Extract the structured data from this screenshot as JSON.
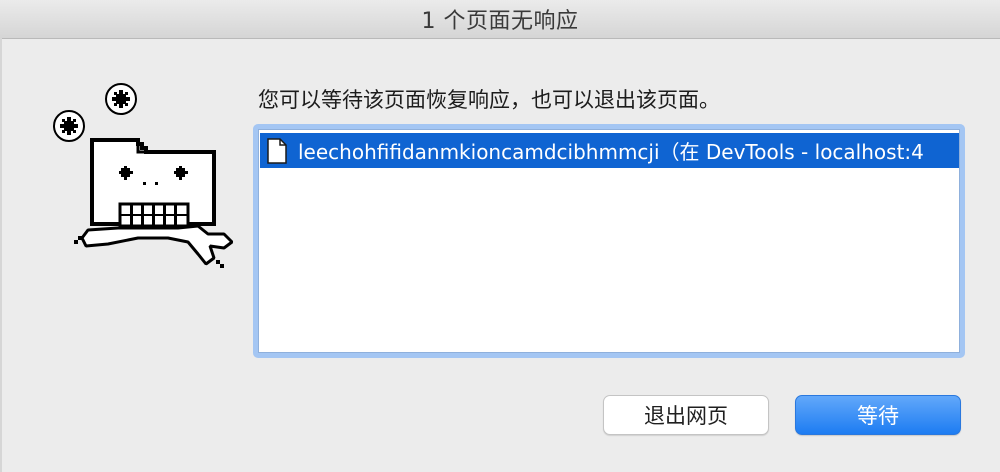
{
  "window": {
    "title": "1 个页面无响应"
  },
  "dialog": {
    "message": "您可以等待该页面恢复响应，也可以退出该页面。",
    "pages": [
      {
        "label": "leechohfifidanmkioncamdcibhmmcji（在 DevTools - localhost:4",
        "icon": "document-icon",
        "selected": true
      }
    ],
    "illustration": "frozen-page-dinosaur-icon"
  },
  "buttons": {
    "exit_label": "退出网页",
    "wait_label": "等待"
  },
  "colors": {
    "selection": "#0f64d2",
    "focus_ring": "#a4c6f3",
    "primary_button": "#1d7cf2"
  }
}
